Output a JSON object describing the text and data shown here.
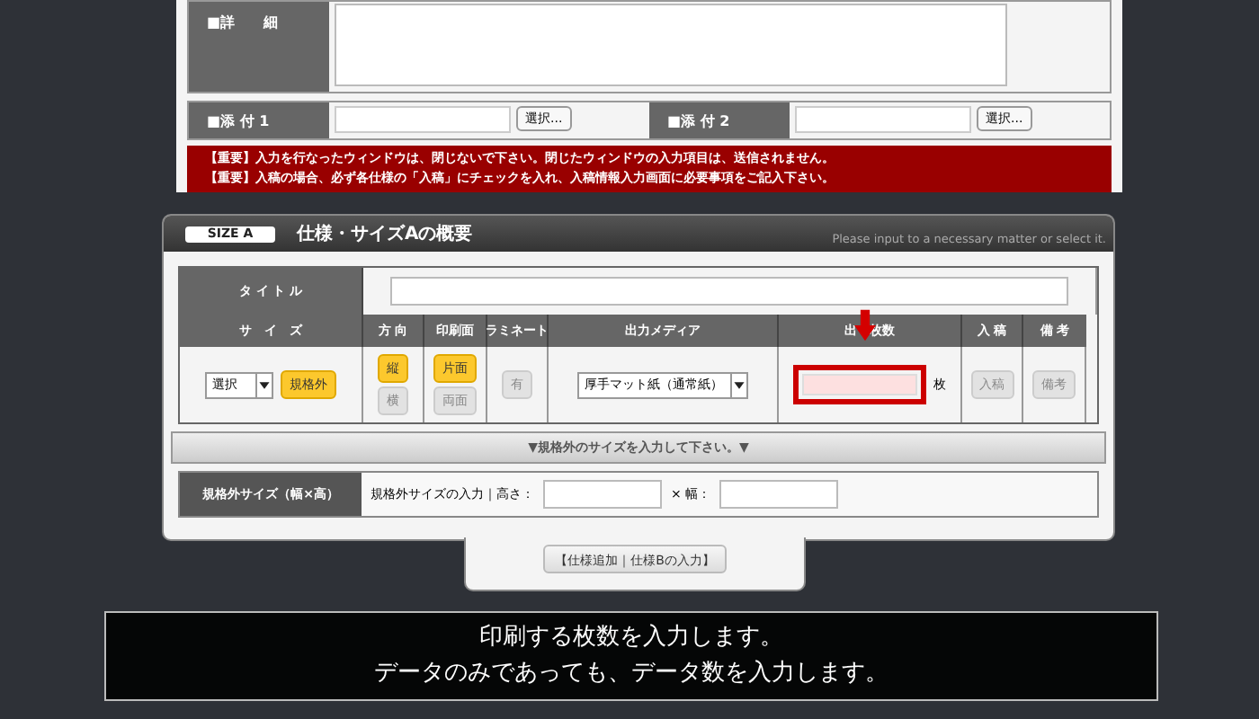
{
  "detail": {
    "label": "■詳　　細"
  },
  "attachments": [
    {
      "label": "■添 付 1",
      "button": "選択..."
    },
    {
      "label": "■添 付 2",
      "button": "選択..."
    }
  ],
  "notices": [
    "【重要】入力を行なったウィンドウは、閉じないで下さい。閉じたウィンドウの入力項目は、送信されません。",
    "【重要】入稿の場合、必ず各仕様の「入稿」にチェックを入れ、入稿情報入力画面に必要事項をご記入下さい。"
  ],
  "section": {
    "badge": "SIZE A",
    "title": "仕様・サイズAの概要",
    "hint": "Please input to a necessary matter or select it."
  },
  "title_row": {
    "label": "タ イ ト ル"
  },
  "columns": [
    "サ　イ　ズ",
    "方 向",
    "印刷面",
    "ラミネート",
    "出力メディア",
    "出　枚数",
    "入 稿",
    "備 考"
  ],
  "size_select": "選択",
  "size_buttons": [
    {
      "label": "規格外",
      "selected": true
    }
  ],
  "direction_buttons": [
    {
      "label": "縦",
      "selected": true
    },
    {
      "label": "横",
      "selected": false
    }
  ],
  "side_buttons": [
    {
      "label": "片面",
      "selected": true
    },
    {
      "label": "両面",
      "selected": false
    }
  ],
  "laminate_buttons": [
    {
      "label": "有",
      "selected": false
    }
  ],
  "media_select": "厚手マット紙（通常紙）",
  "quantity": {
    "unit": "枚",
    "highlighted": true
  },
  "submit_buttons": [
    {
      "label": "入稿",
      "selected": false
    }
  ],
  "note_buttons": [
    {
      "label": "備考",
      "selected": false
    }
  ],
  "custom_bar": "▼規格外のサイズを入力して下さい。▼",
  "custom_row": {
    "label": "規格外サイズ（幅×高）",
    "prompt": "規格外サイズの入力｜高さ：",
    "width_label": "× 幅："
  },
  "add_button": "【仕様追加｜仕様Bの入力】",
  "caption": [
    "印刷する枚数を入力します。",
    "データのみであっても、データ数を入力します。"
  ]
}
